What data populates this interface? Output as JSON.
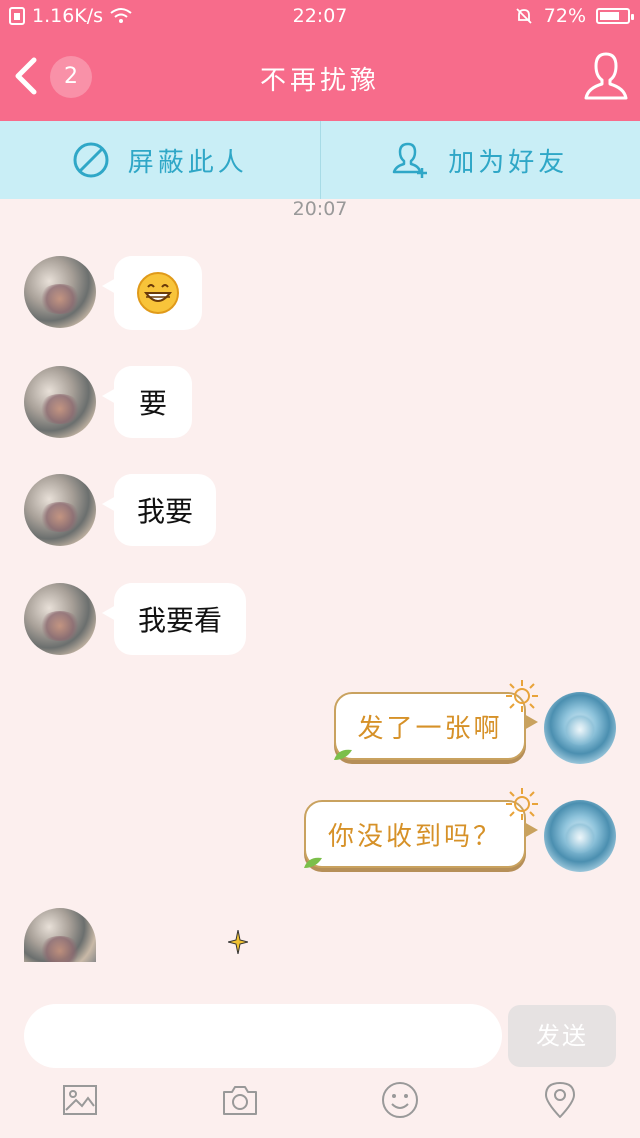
{
  "status_bar": {
    "net_speed": "1.16K/s",
    "time": "22:07",
    "battery": "72%",
    "battery_level": 0.72
  },
  "header": {
    "back_count": "2",
    "title": "不再扰豫"
  },
  "actions": {
    "block": "屏蔽此人",
    "add_friend": "加为好友"
  },
  "chat": {
    "timestamp": "20:07",
    "messages": [
      {
        "side": "left",
        "text": ""
      },
      {
        "side": "left",
        "text": "要"
      },
      {
        "side": "left",
        "text": "我要"
      },
      {
        "side": "left",
        "text": "我要看"
      },
      {
        "side": "right",
        "text": "发了一张啊"
      },
      {
        "side": "right",
        "text": "你没收到吗？"
      }
    ]
  },
  "composer": {
    "input_value": "",
    "send_label": "发送"
  },
  "toolbar": {
    "icons": [
      "image-icon",
      "camera-icon",
      "emoji-icon",
      "location-icon"
    ]
  },
  "colors": {
    "header": "#f76c8b",
    "action_bar": "#c9eef6",
    "background": "#fcefee",
    "accent_text": "#2fa7c7"
  }
}
